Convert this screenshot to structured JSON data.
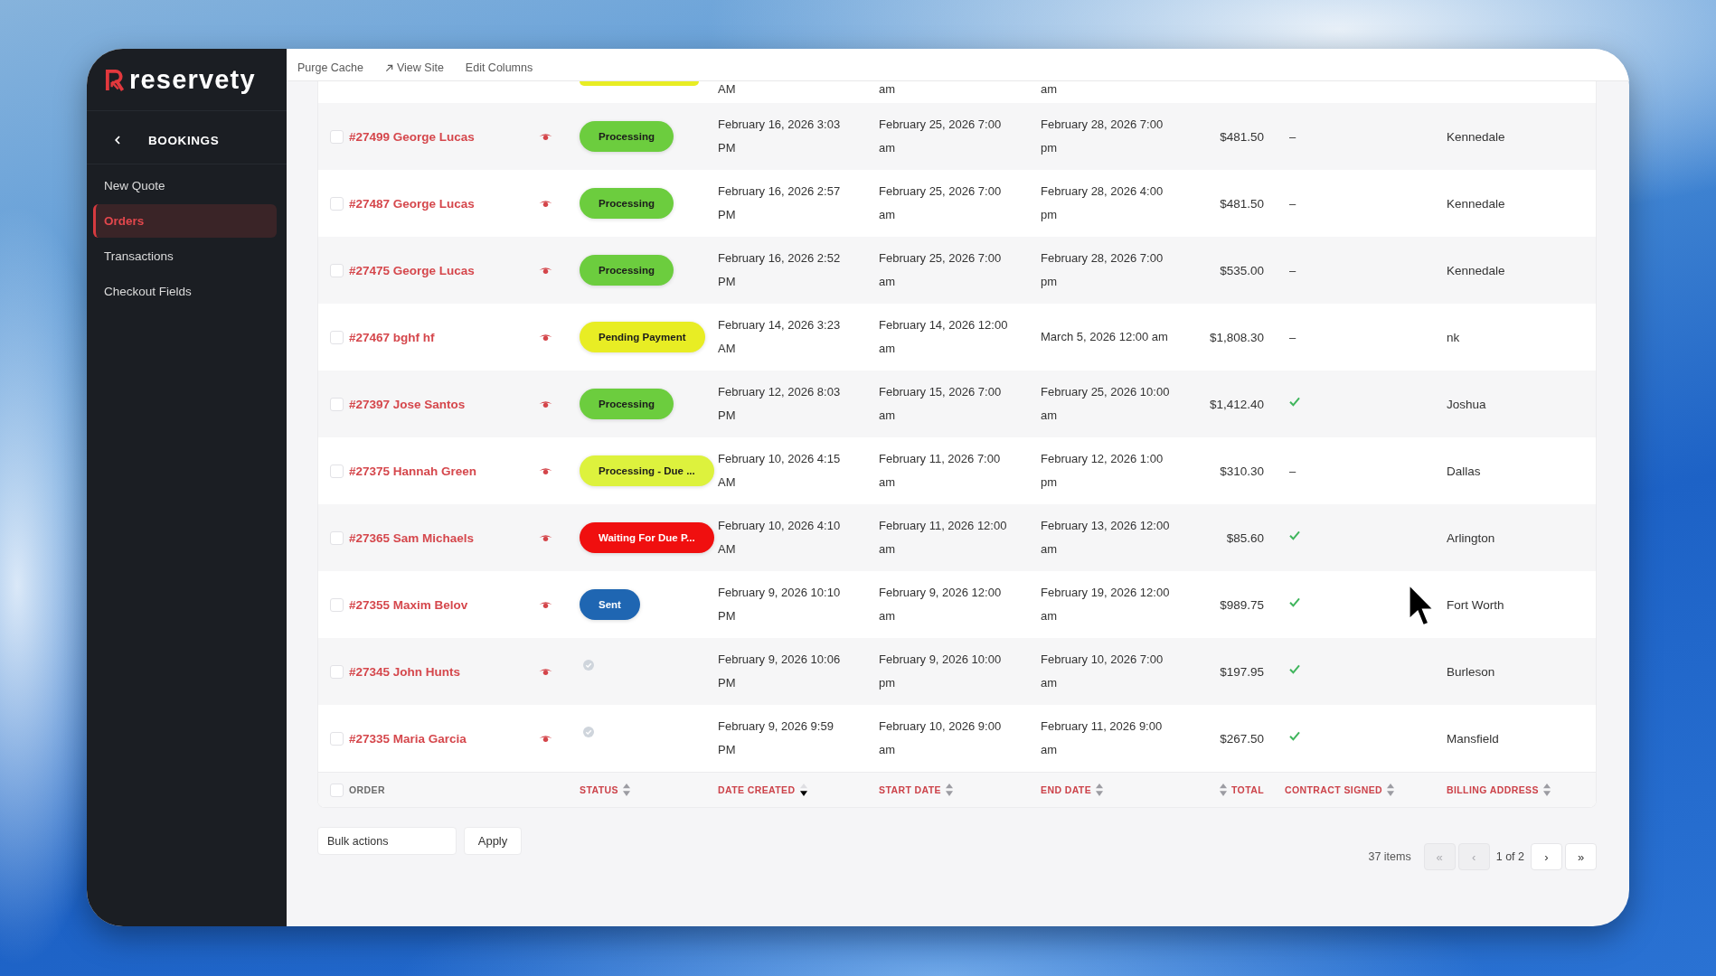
{
  "sidebar": {
    "logo": "reservety",
    "section": "BOOKINGS",
    "items": [
      {
        "label": "New Quote",
        "selected": false
      },
      {
        "label": "Orders",
        "selected": true
      },
      {
        "label": "Transactions",
        "selected": false
      },
      {
        "label": "Checkout Fields",
        "selected": false
      }
    ]
  },
  "toolbar": {
    "links": [
      {
        "label": "Purge Cache",
        "kind": "plain"
      },
      {
        "label": "View Site",
        "kind": "external"
      },
      {
        "label": "Edit Columns",
        "kind": "plain"
      }
    ]
  },
  "table": {
    "rows": [
      {
        "kind": "cut",
        "status": {
          "kind": "badge",
          "color": "#e8ed24"
        },
        "date_created": "AM",
        "start_date": "am",
        "end_date": "am"
      },
      {
        "kind": "order",
        "checked": false,
        "order": "#27499 George Lucas",
        "status": {
          "kind": "badge",
          "label": "Processing",
          "color": "#6ccd3e"
        },
        "date_created": "February 16, 2026 3:03 PM",
        "start_date": "February 25, 2026 7:00 am",
        "end_date": "February 28, 2026 7:00 pm",
        "total": "$481.50",
        "contract": {
          "signed": false,
          "text": "–"
        },
        "billing": "Kennedale"
      },
      {
        "kind": "order",
        "checked": false,
        "order": "#27487 George Lucas",
        "status": {
          "kind": "badge",
          "label": "Processing",
          "color": "#6ccd3e"
        },
        "date_created": "February 16, 2026 2:57 PM",
        "start_date": "February 25, 2026 7:00 am",
        "end_date": "February 28, 2026 4:00 pm",
        "total": "$481.50",
        "contract": {
          "signed": false,
          "text": "–"
        },
        "billing": "Kennedale"
      },
      {
        "kind": "order",
        "checked": false,
        "order": "#27475 George Lucas",
        "status": {
          "kind": "badge",
          "label": "Processing",
          "color": "#6ccd3e"
        },
        "date_created": "February 16, 2026 2:52 PM",
        "start_date": "February 25, 2026 7:00 am",
        "end_date": "February 28, 2026 7:00 pm",
        "total": "$535.00",
        "contract": {
          "signed": false,
          "text": "–"
        },
        "billing": "Kennedale"
      },
      {
        "kind": "order",
        "checked": false,
        "order": "#27467 bghf hf",
        "status": {
          "kind": "badge",
          "label": "Pending Payment",
          "color": "#e8ed24"
        },
        "date_created": "February 14, 2026 3:23 AM",
        "start_date": "February 14, 2026 12:00 am",
        "end_date": "March 5, 2026 12:00 am",
        "total": "$1,808.30",
        "contract": {
          "signed": false,
          "text": "–"
        },
        "billing": "nk"
      },
      {
        "kind": "order",
        "checked": false,
        "order": "#27397 Jose Santos",
        "status": {
          "kind": "badge",
          "label": "Processing",
          "color": "#6ccd3e"
        },
        "date_created": "February 12, 2026 8:03 PM",
        "start_date": "February 15, 2026 7:00 am",
        "end_date": "February 25, 2026 10:00 am",
        "total": "$1,412.40",
        "contract": {
          "signed": true
        },
        "billing": "Joshua"
      },
      {
        "kind": "order",
        "checked": false,
        "order": "#27375 Hannah Green",
        "status": {
          "kind": "badge",
          "label": "Processing - Due ...",
          "color": "#ddf23d"
        },
        "date_created": "February 10, 2026 4:15 AM",
        "start_date": "February 11, 2026 7:00 am",
        "end_date": "February 12, 2026 1:00 pm",
        "total": "$310.30",
        "contract": {
          "signed": false,
          "text": "–"
        },
        "billing": "Dallas"
      },
      {
        "kind": "order",
        "checked": false,
        "order": "#27365 Sam Michaels",
        "status": {
          "kind": "badge",
          "label": "Waiting For Due P...",
          "color": "#f00f0f"
        },
        "date_created": "February 10, 2026 4:10 AM",
        "start_date": "February 11, 2026 12:00 am",
        "end_date": "February 13, 2026 12:00 am",
        "total": "$85.60",
        "contract": {
          "signed": true
        },
        "billing": "Arlington"
      },
      {
        "kind": "order",
        "checked": false,
        "order": "#27355 Maxim Belov",
        "status": {
          "kind": "badge",
          "label": "Sent",
          "color": "#1f66b2"
        },
        "date_created": "February 9, 2026 10:10 PM",
        "start_date": "February 9, 2026 12:00 am",
        "end_date": "February 19, 2026 12:00 am",
        "total": "$989.75",
        "contract": {
          "signed": true
        },
        "billing": "Fort Worth"
      },
      {
        "kind": "order",
        "checked": false,
        "order": "#27345 John Hunts",
        "status": {
          "kind": "icon"
        },
        "date_created": "February 9, 2026 10:06 PM",
        "start_date": "February 9, 2026 10:00 pm",
        "end_date": "February 10, 2026 7:00 am",
        "total": "$197.95",
        "contract": {
          "signed": true
        },
        "billing": "Burleson"
      },
      {
        "kind": "order",
        "checked": false,
        "order": "#27335 Maria Garcia",
        "status": {
          "kind": "icon"
        },
        "date_created": "February 9, 2026 9:59 PM",
        "start_date": "February 10, 2026 9:00 am",
        "end_date": "February 11, 2026 9:00 am",
        "total": "$267.50",
        "contract": {
          "signed": true
        },
        "billing": "Mansfield"
      }
    ],
    "header_checkbox": {
      "checked": false
    },
    "columns": [
      {
        "label": "ORDER",
        "kind": "text",
        "sortable": false,
        "sorted": false
      },
      {
        "label": "STATUS",
        "kind": "text",
        "sortable": true,
        "sorted": false
      },
      {
        "label": "DATE CREATED",
        "kind": "text",
        "sortable": true,
        "sorted": true
      },
      {
        "label": "START DATE",
        "kind": "text",
        "sortable": true,
        "sorted": false
      },
      {
        "label": "END DATE",
        "kind": "text",
        "sortable": true,
        "sorted": false
      },
      {
        "label": "TOTAL",
        "kind": "number",
        "sortable": true,
        "sorted": false
      },
      {
        "label": "CONTRACT SIGNED",
        "kind": "text",
        "sortable": true,
        "sorted": false
      },
      {
        "label": "BILLING ADDRESS",
        "kind": "text",
        "sortable": true,
        "sorted": false
      }
    ]
  },
  "bulk_actions": {
    "value": "Bulk actions",
    "button": "Apply"
  },
  "pagination": {
    "count": "37 items",
    "buttons_before": [
      {
        "label": "«",
        "disabled": true
      },
      {
        "label": "‹",
        "disabled": true
      }
    ],
    "page": "1 of 2",
    "buttons_after": [
      {
        "label": "›",
        "disabled": false
      },
      {
        "label": "»",
        "disabled": false
      }
    ]
  }
}
